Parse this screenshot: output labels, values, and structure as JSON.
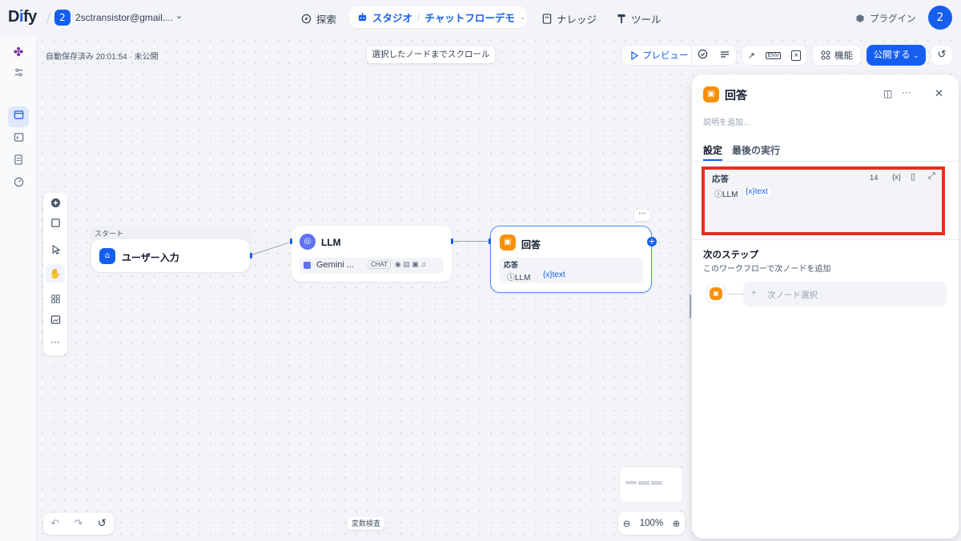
{
  "app": {
    "logo": "Dify",
    "logo_parts": [
      "D",
      "i",
      "fy"
    ]
  },
  "workspace": {
    "badge": "2",
    "name": "2sctransistor@gmail...."
  },
  "nav": {
    "explore": "探索",
    "studio": "スタジオ",
    "app_name": "チャットフローデモ",
    "knowledge": "ナレッジ",
    "tools": "ツール"
  },
  "header_right": {
    "plugin": "プラグイン",
    "avatar": "2"
  },
  "canvas": {
    "autosave": "自動保存済み 20:01:54 · 未公開",
    "scroll_to_node": "選択したノードまでスクロール"
  },
  "toolbar": {
    "preview": "プレビュー",
    "features": "機能",
    "publish": "公開する"
  },
  "nodes": {
    "start": {
      "group_label": "スタート",
      "title": "ユーザー入力"
    },
    "llm": {
      "title": "LLM",
      "model": "Gemini ...",
      "mode": "CHAT"
    },
    "answer": {
      "title": "回答",
      "field_label": "応答",
      "var_source": "LLM",
      "var_name": "text"
    }
  },
  "panel": {
    "title": "回答",
    "description_placeholder": "説明を追加...",
    "tabs": [
      "設定",
      "最後の実行"
    ],
    "answer_label": "応答",
    "answer_count": "14",
    "answer_var_source": "LLM",
    "answer_var_name": "text",
    "next_step_title": "次のステップ",
    "next_step_desc": "このワークフローで次ノードを追加",
    "next_node_select": "次ノード選択"
  },
  "bottom": {
    "var_check": "変数検査",
    "zoom": "100%"
  },
  "colors": {
    "primary": "#155eef",
    "answer_node": "#f79009",
    "llm_node": "#6172f3",
    "highlight": "#e62e1f"
  }
}
